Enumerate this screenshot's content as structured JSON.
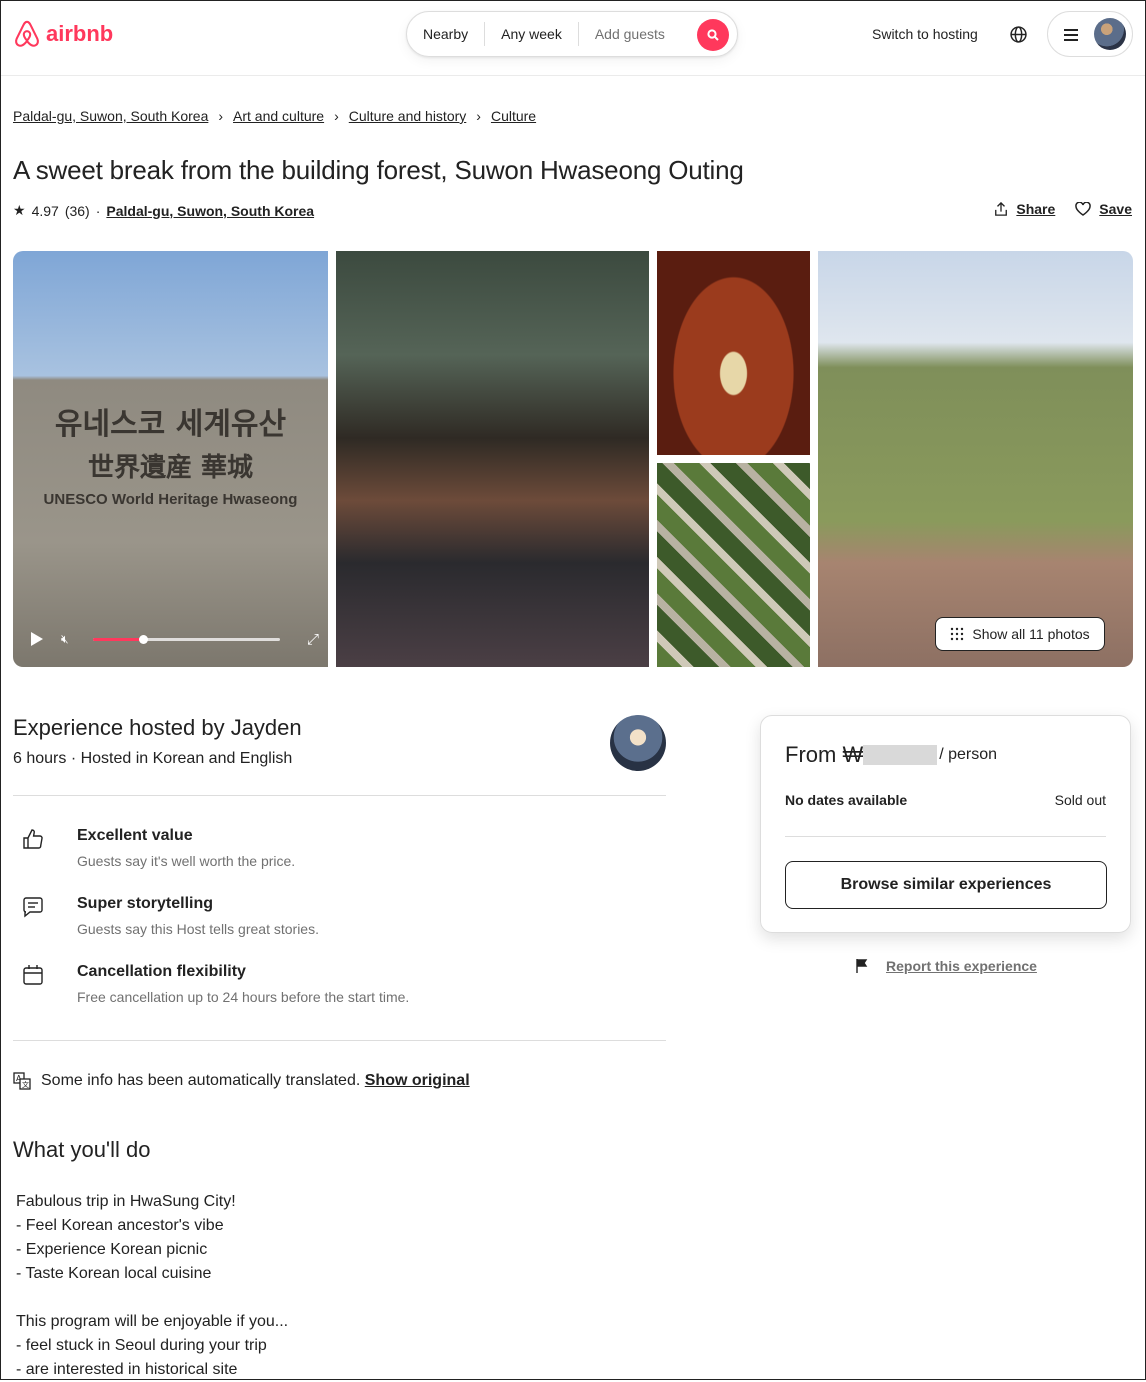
{
  "brand": {
    "name": "airbnb",
    "color": "#FF385C"
  },
  "search": {
    "nearby": "Nearby",
    "week": "Any week",
    "guests": "Add guests"
  },
  "header": {
    "switch_hosting": "Switch to hosting"
  },
  "breadcrumb": [
    "Paldal-gu, Suwon, South Korea",
    "Art and culture",
    "Culture and history",
    "Culture"
  ],
  "listing": {
    "title": "A sweet break from the building forest, Suwon Hwaseong Outing",
    "rating": "4.97",
    "reviews": "(36)",
    "location": "Paldal-gu, Suwon, South Korea",
    "share": "Share",
    "save": "Save"
  },
  "gallery": {
    "stone_line1": "유네스코 세계유산",
    "stone_line2": "世界遺産 華城",
    "stone_line3": "UNESCO World Heritage Hwaseong",
    "show_all": "Show all 11 photos",
    "video_progress": 0.27
  },
  "host": {
    "title": "Experience hosted by Jayden",
    "subtitle": "6 hours · Hosted in Korean and English"
  },
  "highlights": [
    {
      "icon": "thumbs-up-icon",
      "title": "Excellent value",
      "desc": "Guests say it's well worth the price."
    },
    {
      "icon": "chat-icon",
      "title": "Super storytelling",
      "desc": "Guests say this Host tells great stories."
    },
    {
      "icon": "calendar-icon",
      "title": "Cancellation flexibility",
      "desc": "Free cancellation up to 24 hours before the start time."
    }
  ],
  "translation": {
    "text": "Some info has been automatically translated.",
    "link": "Show original"
  },
  "what_youll_do": {
    "title": "What you'll do",
    "body": "Fabulous trip in HwaSung City!\n- Feel Korean ancestor's vibe\n- Experience Korean picnic\n- Taste Korean local cuisine\n\nThis program will be enjoyable if you...\n- feel stuck in Seoul during your trip\n- are interested in historical site"
  },
  "booking": {
    "from": "From ₩",
    "per": "/ person",
    "no_dates": "No dates available",
    "status": "Sold out",
    "browse": "Browse similar experiences",
    "report": "Report this experience"
  }
}
